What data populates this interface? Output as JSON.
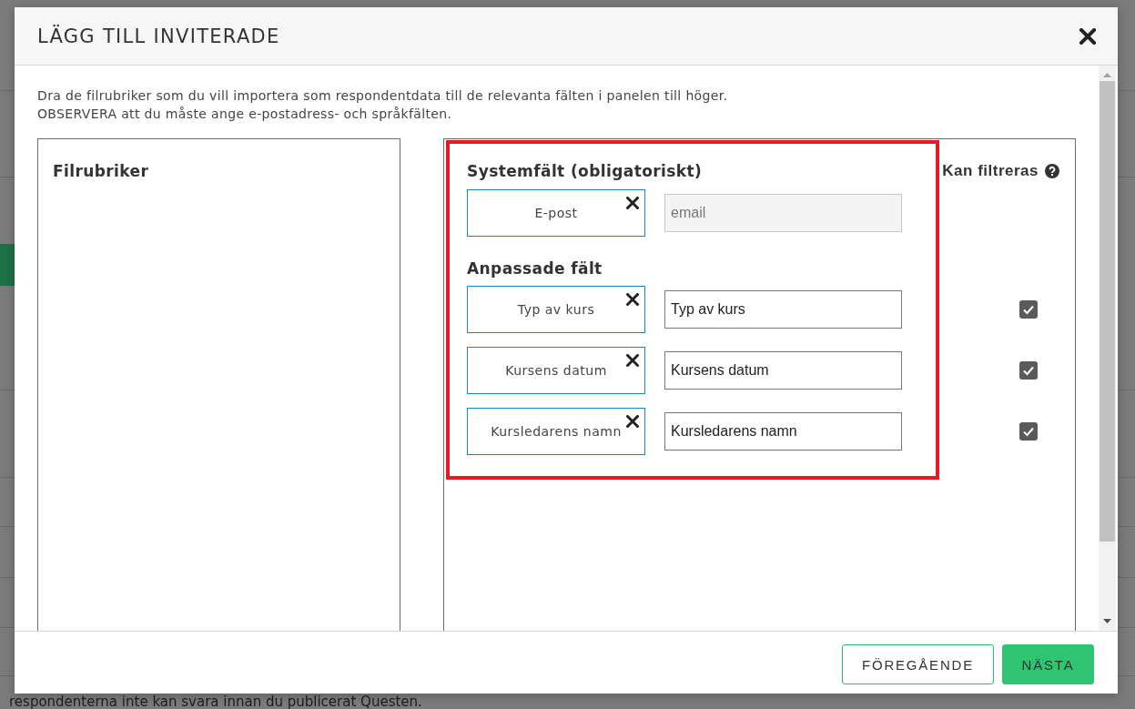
{
  "backdrop": {
    "footnote": "respondenterna inte kan svara innan du publicerat Questen."
  },
  "dialog": {
    "title": "LÄGG TILL INVITERADE",
    "instructions": [
      "Dra de filrubriker som du vill importera som respondentdata till de relevanta fälten i panelen till höger.",
      "OBSERVERA att du måste ange e-postadress- och språkfälten."
    ],
    "file_headers_panel": {
      "title": "Filrubriker"
    },
    "mapping_panel": {
      "highlighted": true,
      "filter_heading": "Kan filtreras",
      "sections": [
        {
          "title": "Systemfält (obligatoriskt)",
          "rows": [
            {
              "header": "E-post",
              "field": {
                "value": "email",
                "disabled": true
              }
            }
          ]
        },
        {
          "title": "Anpassade fält",
          "rows": [
            {
              "header": "Typ av kurs",
              "field": {
                "value": "Typ av kurs",
                "disabled": false
              },
              "filter_checkbox": {
                "checked": true
              }
            },
            {
              "header": "Kursens datum",
              "field": {
                "value": "Kursens datum",
                "disabled": false
              },
              "filter_checkbox": {
                "checked": true
              }
            },
            {
              "header": "Kursledarens namn",
              "field": {
                "value": "Kursledarens namn",
                "disabled": false
              },
              "filter_checkbox": {
                "checked": true
              }
            }
          ]
        }
      ]
    },
    "buttons": [
      {
        "label": "FÖREGÅENDE",
        "kind": "secondary"
      },
      {
        "label": "NÄSTA",
        "kind": "primary"
      }
    ]
  }
}
